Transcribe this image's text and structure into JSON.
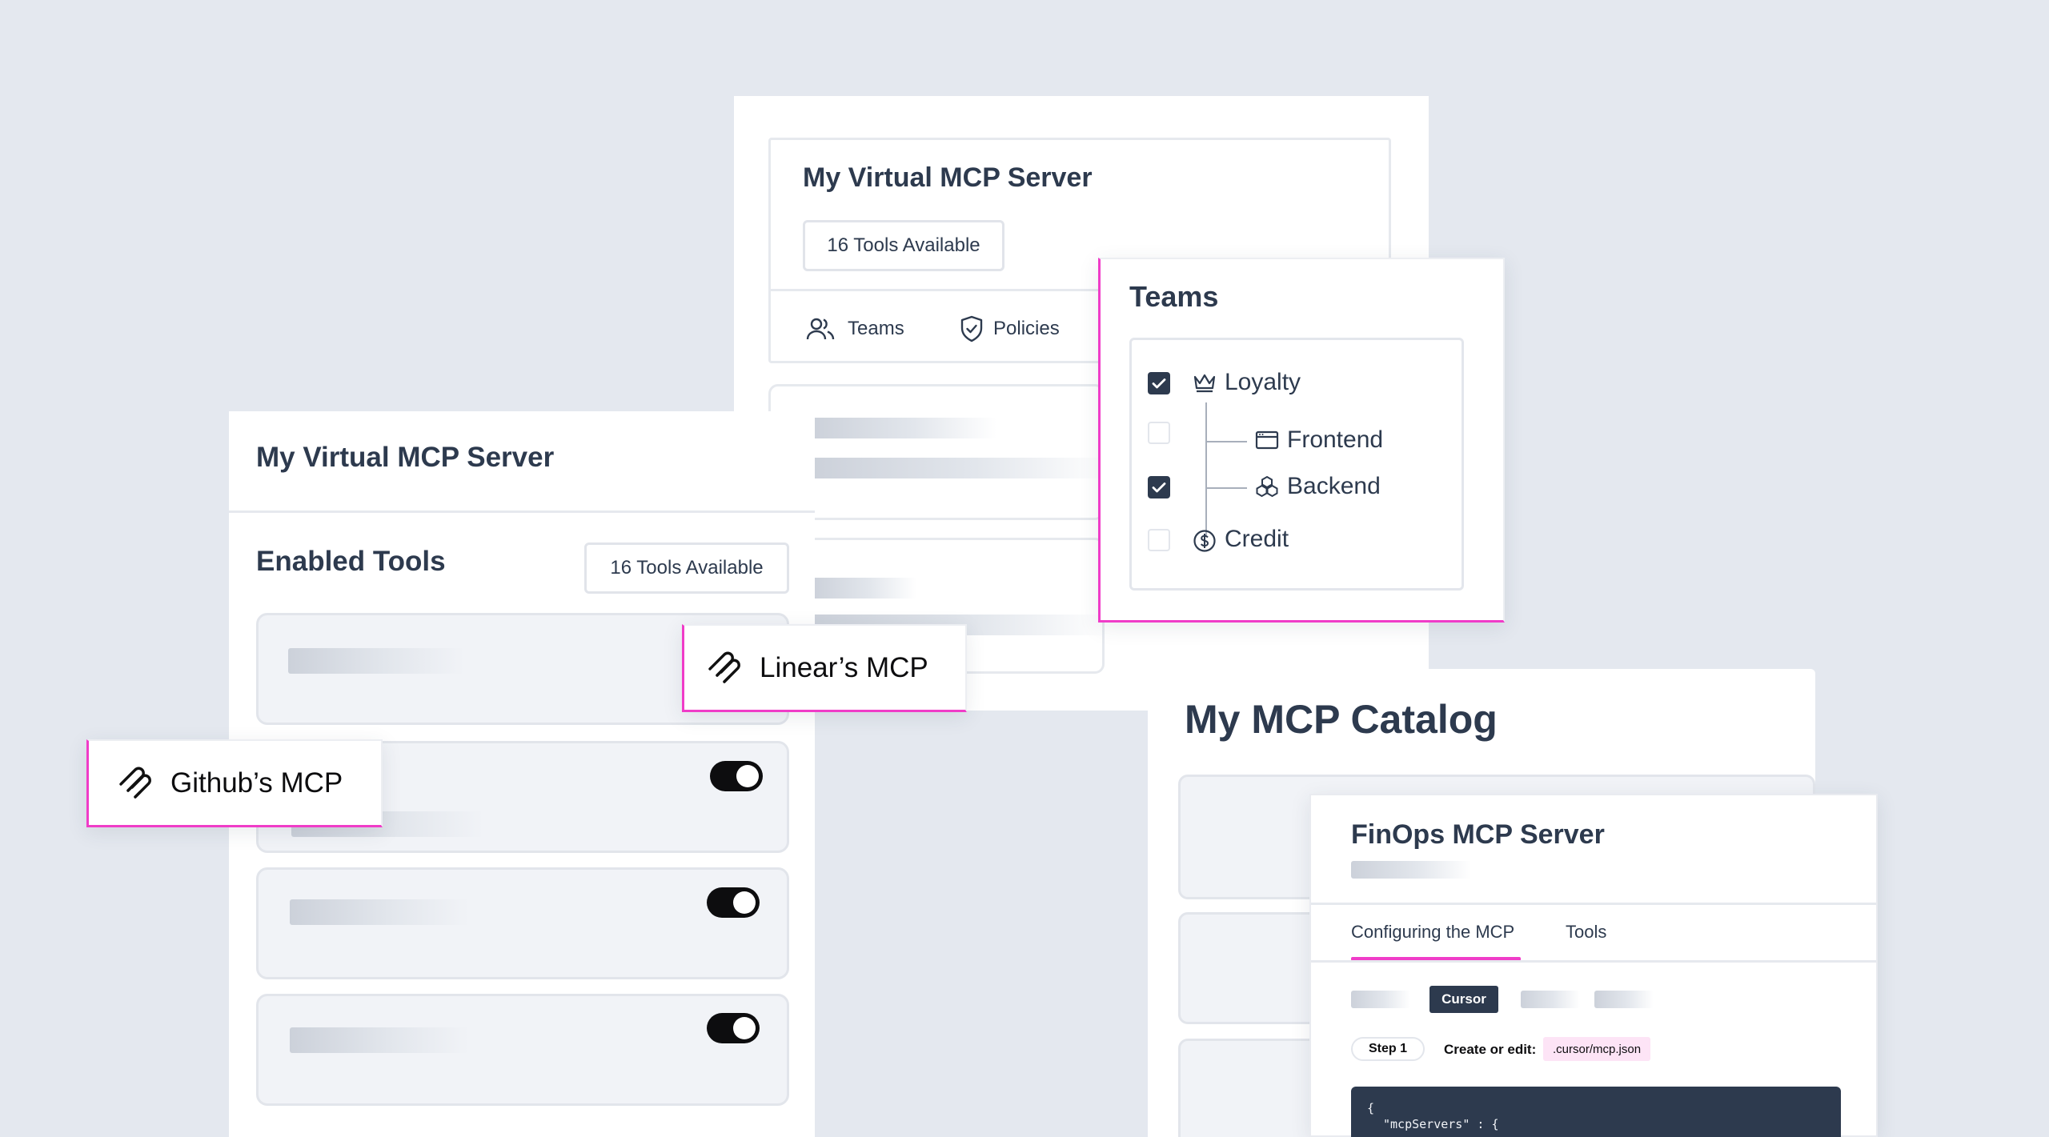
{
  "back_card": {
    "title": "My Virtual MCP Server",
    "tools_pill": "16 Tools Available",
    "tabs": [
      {
        "label": "Teams",
        "icon": "users-icon"
      },
      {
        "label": "Policies",
        "icon": "shield-icon"
      }
    ]
  },
  "teams_card": {
    "title": "Teams",
    "items": [
      {
        "label": "Loyalty",
        "checked": true,
        "icon": "crown-icon"
      },
      {
        "label": "Frontend",
        "checked": false,
        "icon": "browser-window-icon"
      },
      {
        "label": "Backend",
        "checked": true,
        "icon": "cubes-icon"
      },
      {
        "label": "Credit",
        "checked": false,
        "icon": "dollar-circle-icon"
      }
    ]
  },
  "left_card": {
    "title": "My Virtual MCP Server",
    "section_title": "Enabled Tools",
    "tools_pill": "16 Tools Available",
    "toggles_on": [
      true,
      true,
      true
    ]
  },
  "badges": {
    "linear": "Linear’s MCP",
    "github": "Github’s MCP"
  },
  "catalog": {
    "title": "My MCP Catalog"
  },
  "finops": {
    "title": "FinOps MCP Server",
    "tabs": [
      "Configuring the MCP",
      "Tools"
    ],
    "active_tab": "Configuring the MCP",
    "client_selected": "Cursor",
    "step_label": "Step 1",
    "instruction": "Create or edit:",
    "file_path": ".cursor/mcp.json",
    "code_lines": [
      "{",
      "\"mcpServers\" : {"
    ]
  },
  "colors": {
    "background": "#e4e8ef",
    "accent_pink": "#f03cc8",
    "navy": "#2d3a4e",
    "code_bg": "#2d3a4e"
  }
}
